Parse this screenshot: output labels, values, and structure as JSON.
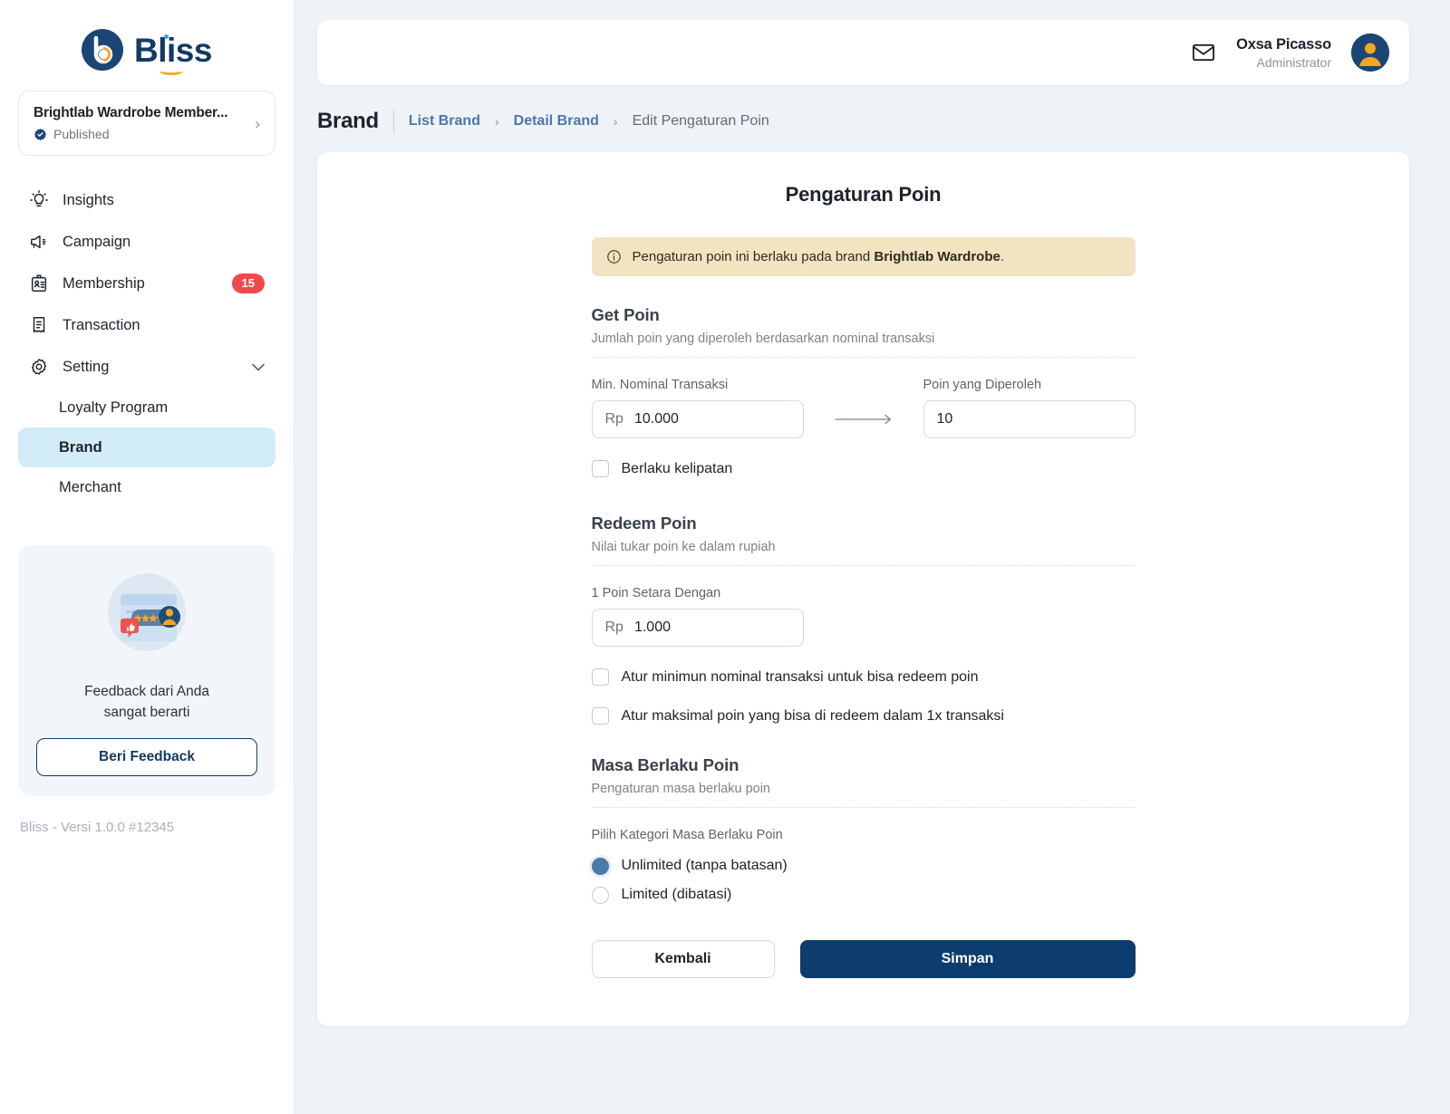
{
  "sidebar": {
    "logo": {
      "word": "Bliss",
      "mark_icon": "bliss-logo-icon"
    },
    "brand_card": {
      "title": "Brightlab Wardrobe Member...",
      "status": "Published",
      "status_icon": "verified-badge-icon",
      "chevron": "›"
    },
    "nav": [
      {
        "label": "Insights",
        "icon": "lightbulb-icon"
      },
      {
        "label": "Campaign",
        "icon": "megaphone-icon"
      },
      {
        "label": "Membership",
        "icon": "id-card-icon",
        "badge": "15"
      },
      {
        "label": "Transaction",
        "icon": "receipt-icon"
      },
      {
        "label": "Setting",
        "icon": "gear-icon",
        "chevron": "∨"
      }
    ],
    "subnav": [
      {
        "label": "Loyalty Program",
        "active": false
      },
      {
        "label": "Brand",
        "active": true
      },
      {
        "label": "Merchant",
        "active": false
      }
    ],
    "feedback": {
      "line1": "Feedback dari Anda",
      "line2": "sangat berarti",
      "button": "Beri Feedback"
    },
    "version": "Bliss - Versi 1.0.0 #12345"
  },
  "topbar": {
    "mail_icon": "envelope-icon",
    "user_name": "Oxsa Picasso",
    "user_role": "Administrator",
    "avatar_icon": "user-avatar-icon"
  },
  "breadcrumb": {
    "page_title": "Brand",
    "links": [
      "List Brand",
      "Detail Brand"
    ],
    "separator": "›",
    "current": "Edit Pengaturan Poin"
  },
  "form": {
    "title": "Pengaturan Poin",
    "alert": {
      "icon": "info-circle-icon",
      "text_before": "Pengaturan poin ini berlaku pada brand ",
      "bold": "Brightlab Wardrobe",
      "text_after": "."
    },
    "get_poin": {
      "heading": "Get Poin",
      "subheading": "Jumlah poin yang diperoleh berdasarkan nominal transaksi",
      "min_label": "Min. Nominal Transaksi",
      "min_prefix": "Rp",
      "min_value": "10.000",
      "arrow_icon": "arrow-right-icon",
      "points_label": "Poin yang Diperoleh",
      "points_value": "10",
      "multiplier_label": "Berlaku kelipatan",
      "multiplier_checked": false
    },
    "redeem_poin": {
      "heading": "Redeem Poin",
      "subheading": "Nilai tukar poin ke dalam rupiah",
      "rate_label": "1 Poin Setara Dengan",
      "rate_prefix": "Rp",
      "rate_value": "1.000",
      "option_min_label": "Atur minimun nominal transaksi untuk bisa redeem poin",
      "option_min_checked": false,
      "option_max_label": "Atur maksimal poin yang bisa di redeem dalam 1x transaksi",
      "option_max_checked": false
    },
    "masa_berlaku": {
      "heading": "Masa Berlaku Poin",
      "subheading": "Pengaturan masa berlaku poin",
      "category_label": "Pilih Kategori Masa Berlaku Poin",
      "options": [
        {
          "label": "Unlimited (tanpa batasan)",
          "selected": true
        },
        {
          "label": "Limited (dibatasi)",
          "selected": false
        }
      ]
    },
    "buttons": {
      "back": "Kembali",
      "save": "Simpan"
    }
  },
  "colors": {
    "page_bg": "#eef3f8",
    "brand_navy": "#123a63",
    "save_navy": "#0d3c6e",
    "link_blue": "#4a77ad",
    "active_nav": "#d2ecf7",
    "badge_red": "#ef4b4b",
    "alert_cream": "#f2e4c1",
    "radio_blue": "#4a7ba8",
    "accent_orange": "#f5a623"
  }
}
